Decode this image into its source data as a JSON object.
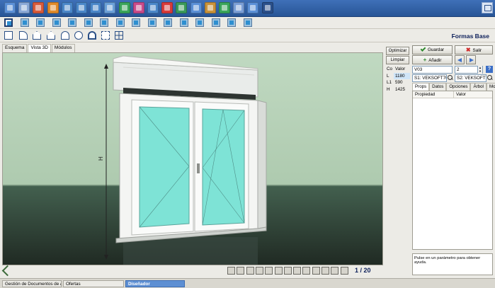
{
  "window": {
    "title": "Formas Base",
    "controls_icon": "window-restore-icon"
  },
  "top_toolbar": {
    "icons": [
      {
        "name": "document-icon",
        "color": "#5a8fd6"
      },
      {
        "name": "building-icon",
        "color": "#8aa8d6"
      },
      {
        "name": "tools-icon",
        "color": "#d85a3a"
      },
      {
        "name": "folder-icon",
        "color": "#e08a2a"
      },
      {
        "name": "catalog-icon",
        "color": "#4a86c8"
      },
      {
        "name": "report-icon",
        "color": "#4a86c8"
      },
      {
        "name": "list-icon",
        "color": "#4a86c8"
      },
      {
        "name": "calculator-icon",
        "color": "#6aa0d8"
      },
      {
        "name": "shapes-icon",
        "color": "#3aa55a"
      },
      {
        "name": "colors-icon",
        "color": "#c94a8a"
      },
      {
        "name": "cube-icon",
        "color": "#4a86c8"
      },
      {
        "name": "delete-icon",
        "color": "#d83a3a"
      },
      {
        "name": "chart-icon",
        "color": "#3a9a5a"
      },
      {
        "name": "layers-icon",
        "color": "#5a8fd6"
      },
      {
        "name": "box-icon",
        "color": "#c8923a"
      },
      {
        "name": "refresh-icon",
        "color": "#3aa55a"
      },
      {
        "name": "users-icon",
        "color": "#7a9ed6"
      },
      {
        "name": "notes-icon",
        "color": "#5a8fd6"
      },
      {
        "name": "power-icon",
        "color": "#2a4f8a"
      }
    ]
  },
  "tabs": {
    "items": [
      "Esquema",
      "Vista 3D",
      "Módulos"
    ],
    "active": "Vista 3D"
  },
  "measures": {
    "optimize_label": "Optimizar",
    "clear_label": "Limpiar",
    "columns": [
      "Co",
      "Valor"
    ],
    "rows": [
      {
        "key": "L",
        "value": "1180"
      },
      {
        "key": "L1",
        "value": "590"
      },
      {
        "key": "H",
        "value": "1425"
      }
    ]
  },
  "right_panel": {
    "save_label": "Guardar",
    "exit_label": "Salir",
    "add_label": "Añadir",
    "code_value": "V03",
    "count_value": "2",
    "profile_a": "S1: VEKSOFT70C",
    "profile_b": "S2: VEKSOFT70C",
    "tabs": [
      "Props",
      "Datos",
      "Opciones",
      "Árbol",
      "Modelos"
    ],
    "active_tab": "Props",
    "grid_headers": [
      "Propiedad",
      "Valor"
    ],
    "help_text": "Pulse en un parámetro para obtener ayuda."
  },
  "viewer": {
    "page_counter": "1 / 20",
    "dimension_label": "H",
    "toolbar_icons": [
      "frame-icon",
      "page-icon",
      "grid-icon",
      "link-icon",
      "paint-icon",
      "camera-icon",
      "copy-icon",
      "print-icon",
      "trash-icon",
      "camera2-icon",
      "palette-icon",
      "settings-icon",
      "zoom-icon"
    ]
  },
  "status_bar": {
    "items": [
      "Gestión de Documentos de Almacén",
      "Ofertas",
      "Diseñador"
    ],
    "active": "Diseñador"
  }
}
